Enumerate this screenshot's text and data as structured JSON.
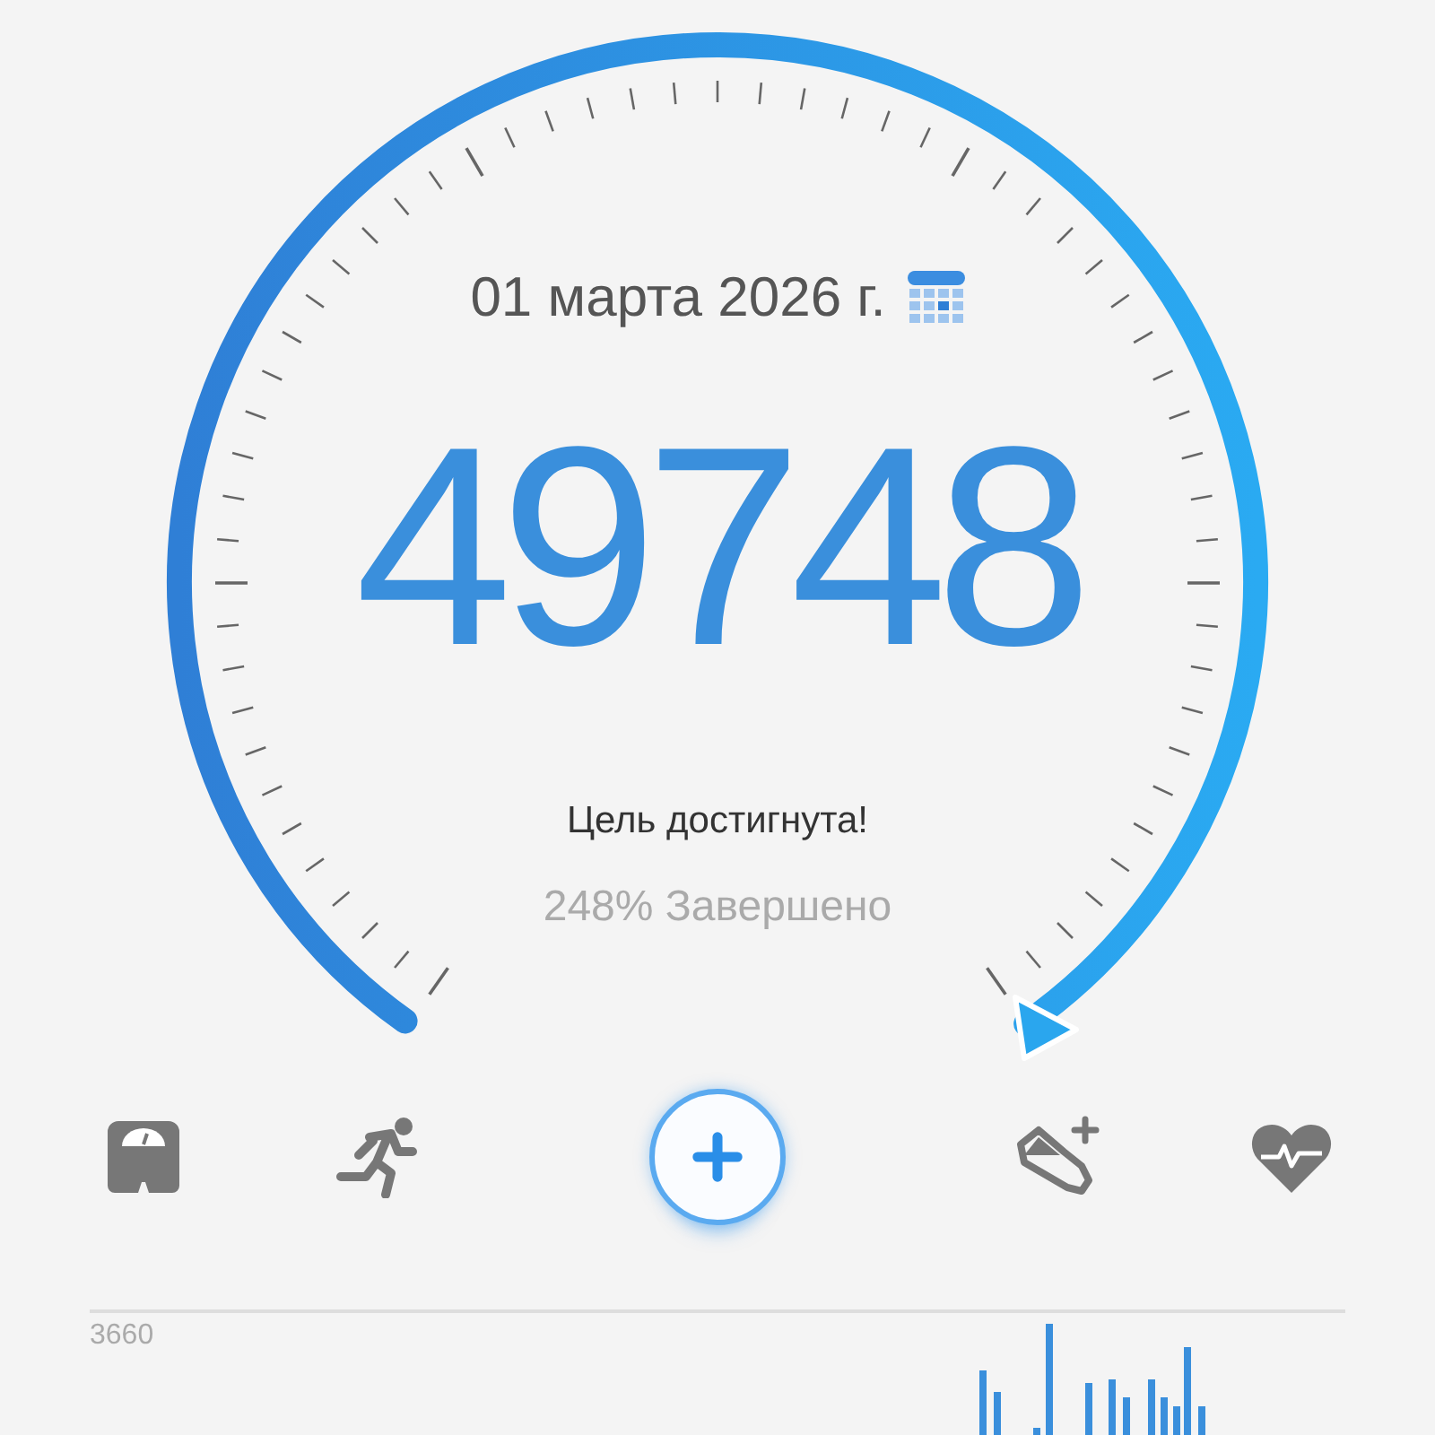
{
  "date": "01 марта 2026 г.",
  "steps": "49748",
  "goal_message": "Цель достигнута!",
  "completion": "248% Завершено",
  "chart": {
    "max_label": "3660"
  }
}
